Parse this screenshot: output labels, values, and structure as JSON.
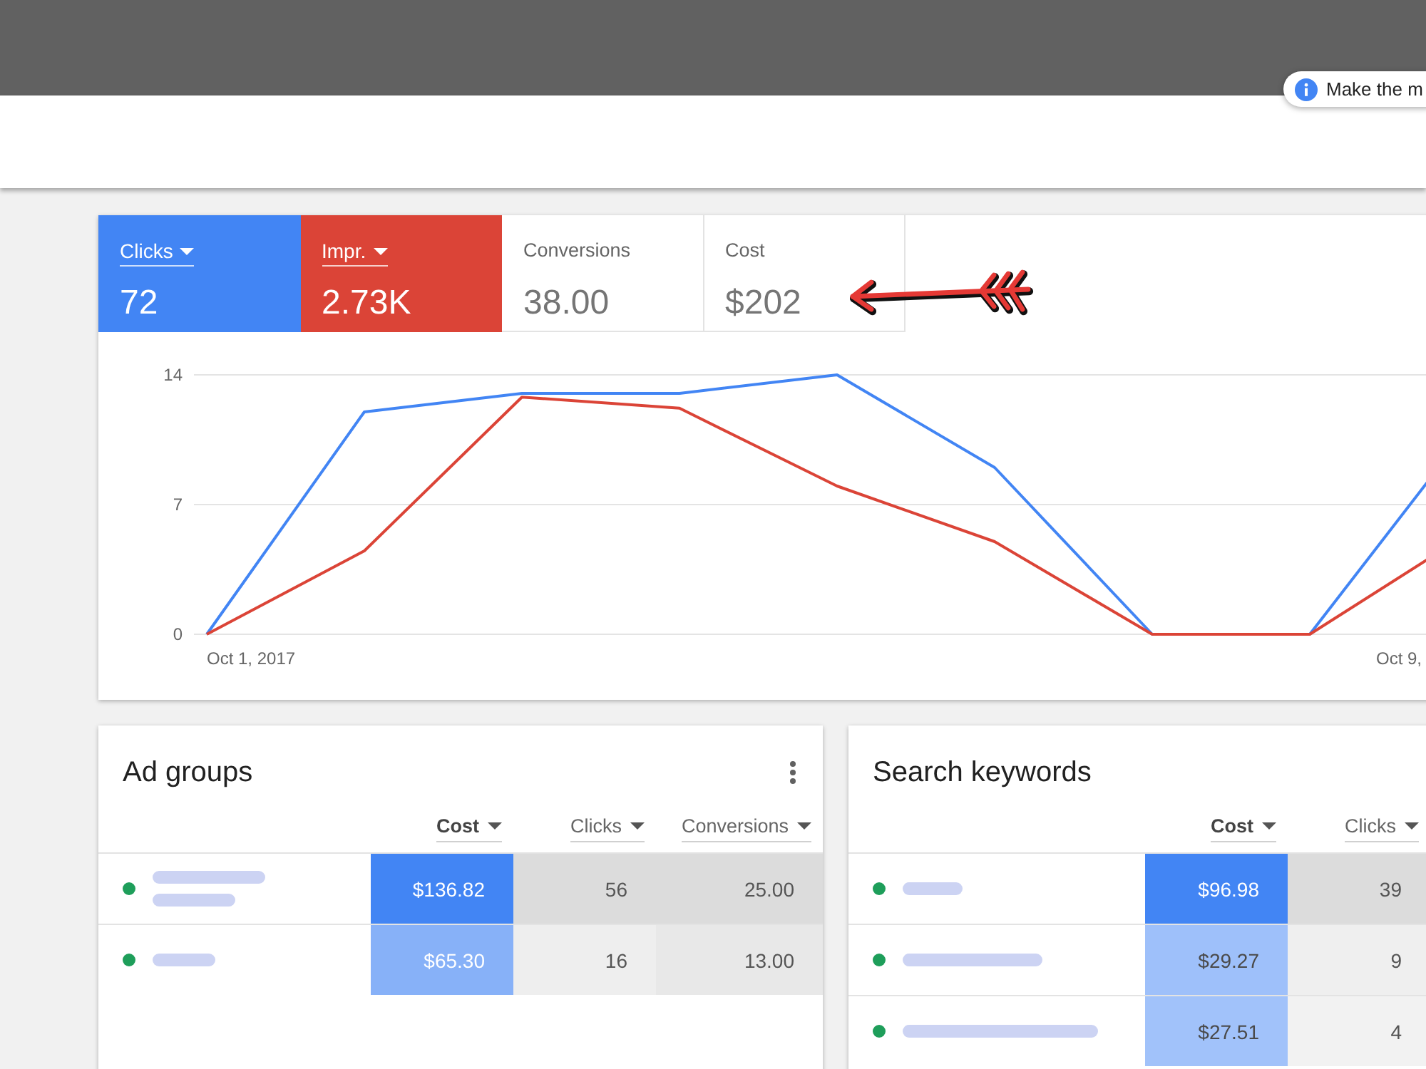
{
  "hint_chip": {
    "text": "Make the m"
  },
  "metrics": [
    {
      "label": "Clicks",
      "value": "72",
      "selected": true,
      "color": "#4285f4"
    },
    {
      "label": "Impr.",
      "value": "2.73K",
      "selected": true,
      "color": "#db4437"
    },
    {
      "label": "Conversions",
      "value": "38.00",
      "selected": false
    },
    {
      "label": "Cost",
      "value": "$202",
      "selected": false
    }
  ],
  "chart": {
    "chart_data": {
      "type": "line",
      "categories": [
        "Oct 1, 2017",
        null,
        null,
        null,
        null,
        null,
        null,
        null,
        "Oct 9"
      ],
      "ylim": [
        0,
        14
      ],
      "yticks": [
        0,
        7,
        14
      ],
      "series": [
        {
          "color": "#4285f4",
          "values": [
            0,
            12,
            13,
            13,
            14,
            9,
            0,
            0,
            11
          ]
        },
        {
          "color": "#db4437",
          "values": [
            0,
            4.5,
            12.8,
            12.2,
            8,
            5,
            0,
            0,
            5.4
          ]
        }
      ]
    },
    "last_label_separator": ","
  },
  "tables": [
    {
      "title": "Ad groups",
      "menu": true,
      "columns": [
        {
          "label": "Cost",
          "kind": "cost",
          "selected": true
        },
        {
          "label": "Clicks",
          "kind": "clicks",
          "selected": false
        },
        {
          "label": "Conversions",
          "kind": "conversions",
          "selected": false
        }
      ],
      "rows": [
        {
          "enabled": true,
          "cells": [
            "$136.82",
            "56",
            "25.00"
          ]
        },
        {
          "enabled": true,
          "cells": [
            "$65.30",
            "16",
            "13.00"
          ]
        }
      ]
    },
    {
      "title": "Search keywords",
      "menu": false,
      "columns": [
        {
          "label": "Cost",
          "kind": "cost",
          "selected": true
        },
        {
          "label": "Clicks",
          "kind": "clicks",
          "selected": false
        }
      ],
      "rows": [
        {
          "enabled": true,
          "cells": [
            "$96.98",
            "39"
          ]
        },
        {
          "enabled": true,
          "cells": [
            "$29.27",
            "9"
          ]
        },
        {
          "enabled": true,
          "cells": [
            "$27.51",
            "4"
          ]
        }
      ]
    }
  ]
}
